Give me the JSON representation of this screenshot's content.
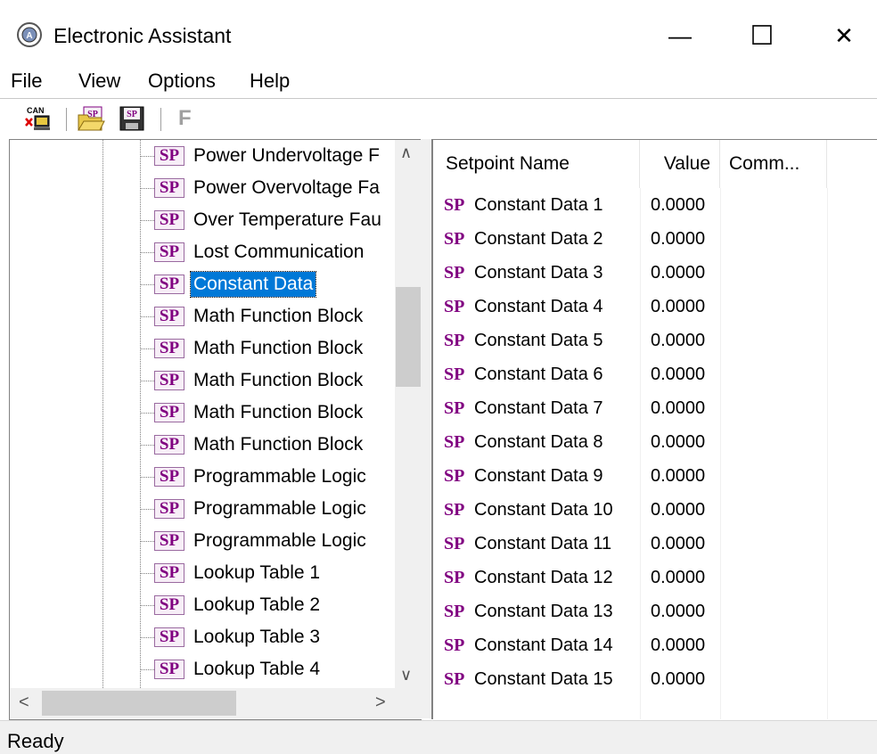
{
  "window": {
    "title": "Electronic Assistant",
    "minimize_glyph": "—",
    "maximize_glyph": "☐",
    "close_glyph": "✕"
  },
  "menu": {
    "items": [
      "File",
      "View",
      "Options",
      "Help"
    ]
  },
  "toolbar": {
    "buttons": [
      {
        "icon": "can-connect-icon",
        "label": "CAN"
      },
      {
        "icon": "sp-open-icon",
        "label": "SP"
      },
      {
        "icon": "sp-save-icon",
        "label": "SP"
      },
      {
        "icon": "flash-icon",
        "label": "F"
      }
    ]
  },
  "tree": {
    "icon_label": "SP",
    "items": [
      "Power Undervoltage F",
      "Power Overvoltage Fa",
      "Over Temperature Fau",
      "Lost Communication",
      "Constant Data",
      "Math Function Block",
      "Math Function Block",
      "Math Function Block",
      "Math Function Block",
      "Math Function Block",
      "Programmable Logic",
      "Programmable Logic",
      "Programmable Logic",
      "Lookup Table 1",
      "Lookup Table 2",
      "Lookup Table 3",
      "Lookup Table 4"
    ],
    "selected_index": 4,
    "scroll_up_glyph": "∧",
    "scroll_down_glyph": "∨",
    "scroll_left_glyph": "<",
    "scroll_right_glyph": ">"
  },
  "list": {
    "columns": [
      "Setpoint Name",
      "Value",
      "Comm..."
    ],
    "icon_label": "SP",
    "rows": [
      {
        "name": "Constant Data 1",
        "value": "0.0000"
      },
      {
        "name": "Constant Data 2",
        "value": "0.0000"
      },
      {
        "name": "Constant Data 3",
        "value": "0.0000"
      },
      {
        "name": "Constant Data 4",
        "value": "0.0000"
      },
      {
        "name": "Constant Data 5",
        "value": "0.0000"
      },
      {
        "name": "Constant Data 6",
        "value": "0.0000"
      },
      {
        "name": "Constant Data 7",
        "value": "0.0000"
      },
      {
        "name": "Constant Data 8",
        "value": "0.0000"
      },
      {
        "name": "Constant Data 9",
        "value": "0.0000"
      },
      {
        "name": "Constant Data 10",
        "value": "0.0000"
      },
      {
        "name": "Constant Data 11",
        "value": "0.0000"
      },
      {
        "name": "Constant Data 12",
        "value": "0.0000"
      },
      {
        "name": "Constant Data 13",
        "value": "0.0000"
      },
      {
        "name": "Constant Data 14",
        "value": "0.0000"
      },
      {
        "name": "Constant Data 15",
        "value": "0.0000"
      }
    ]
  },
  "status": {
    "text": "Ready"
  },
  "colors": {
    "selection": "#0078d7",
    "sp_purple": "#800080"
  }
}
